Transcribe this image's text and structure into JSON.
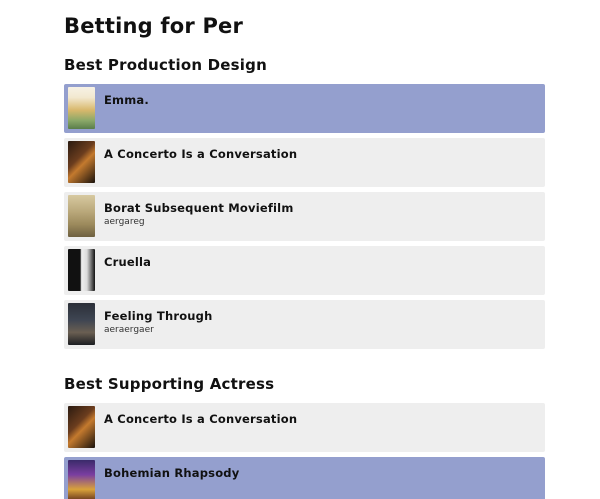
{
  "page": {
    "title": "Betting for Per"
  },
  "sections": [
    {
      "title": "Best Production Design",
      "items": [
        {
          "title": "Emma.",
          "note": "",
          "selected": true
        },
        {
          "title": "A Concerto Is a Conversation",
          "note": "",
          "selected": false
        },
        {
          "title": "Borat Subsequent Moviefilm",
          "note": "aergareg",
          "selected": false
        },
        {
          "title": "Cruella",
          "note": "",
          "selected": false
        },
        {
          "title": "Feeling Through",
          "note": "aeraergaer",
          "selected": false
        }
      ]
    },
    {
      "title": "Best Supporting Actress",
      "items": [
        {
          "title": "A Concerto Is a Conversation",
          "note": "",
          "selected": false
        },
        {
          "title": "Bohemian Rhapsody",
          "note": "",
          "selected": true
        }
      ]
    }
  ],
  "colors": {
    "selected_background": "#949fce",
    "card_background": "#eeeeee"
  }
}
